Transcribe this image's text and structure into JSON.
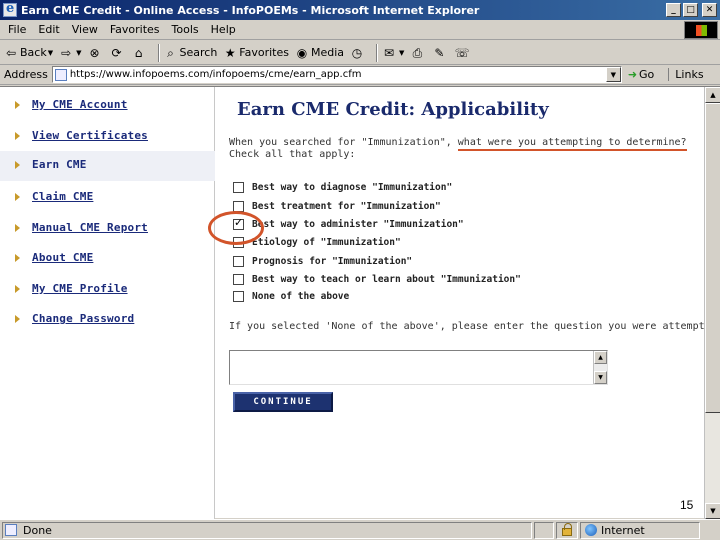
{
  "window": {
    "title": "Earn CME Credit - Online Access - InfoPOEMs - Microsoft Internet Explorer",
    "minimize_glyph": "_",
    "maximize_glyph": "□",
    "close_glyph": "✕"
  },
  "menu": [
    "File",
    "Edit",
    "View",
    "Favorites",
    "Tools",
    "Help"
  ],
  "toolbar": {
    "back": "Back",
    "search": "Search",
    "favorites": "Favorites",
    "media": "Media"
  },
  "address": {
    "label": "Address",
    "url": "https://www.infopoems.com/infopoems/cme/earn_app.cfm",
    "go": "Go",
    "links": "Links"
  },
  "sidebar": {
    "items": [
      {
        "label": "My CME Account"
      },
      {
        "label": "View Certificates"
      },
      {
        "label": "Earn CME",
        "active": true
      },
      {
        "label": "Claim CME"
      },
      {
        "label": "Manual CME Report"
      },
      {
        "label": "About CME"
      },
      {
        "label": "My CME Profile"
      },
      {
        "label": "Change Password"
      }
    ]
  },
  "main": {
    "title": "Earn CME Credit: Applicability",
    "prompt_prefix": "When you searched for \"Immunization\", ",
    "prompt_highlight": "what were you attempting to determine?",
    "prompt_line2": "Check all that apply:",
    "options": [
      {
        "label": "Best way to diagnose \"Immunization\"",
        "checked": false
      },
      {
        "label": "Best treatment for \"Immunization\"",
        "checked": false
      },
      {
        "label": "Best way to administer \"Immunization\"",
        "checked": true
      },
      {
        "label": "Etiology of \"Immunization\"",
        "checked": false
      },
      {
        "label": "Prognosis for \"Immunization\"",
        "checked": false
      },
      {
        "label": "Best way to teach or learn about \"Immunization\"",
        "checked": false
      },
      {
        "label": "None of the above",
        "checked": false
      }
    ],
    "none_prompt": "If you selected 'None of the above', please enter the question you were attempting to answer",
    "textarea_value": "",
    "continue_label": "CONTINUE"
  },
  "slide_number": "15",
  "status": {
    "text": "Done",
    "zone": "Internet"
  },
  "colors": {
    "title_bar": "#0a246a",
    "nav_link": "#1a2a7a",
    "annotation": "#d2542a",
    "button": "#1d3270"
  }
}
